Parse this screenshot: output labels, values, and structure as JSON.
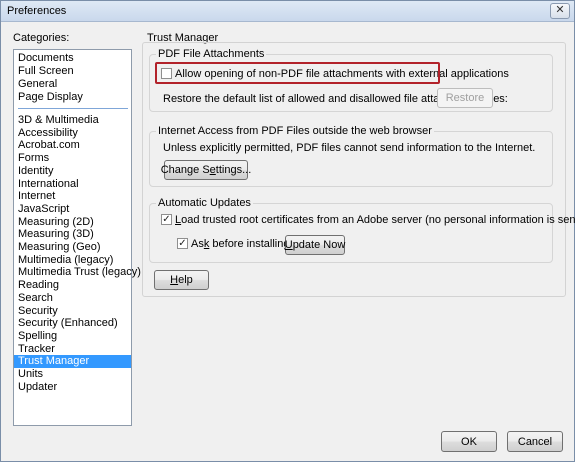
{
  "window": {
    "title": "Preferences",
    "close_glyph": "✕"
  },
  "categories": {
    "label": "Categories:",
    "items": [
      "Documents",
      "Full Screen",
      "General",
      "Page Display",
      "3D & Multimedia",
      "Accessibility",
      "Acrobat.com",
      "Forms",
      "Identity",
      "International",
      "Internet",
      "JavaScript",
      "Measuring (2D)",
      "Measuring (3D)",
      "Measuring (Geo)",
      "Multimedia (legacy)",
      "Multimedia Trust (legacy)",
      "Reading",
      "Search",
      "Security",
      "Security (Enhanced)",
      "Spelling",
      "Tracker",
      "Trust Manager",
      "Units",
      "Updater"
    ],
    "selected": "Trust Manager"
  },
  "trust_manager": {
    "title": "Trust Manager",
    "pdf_attachments": {
      "title": "PDF File Attachments",
      "allow_label": "Allow opening of non-PDF file attachments with external applications",
      "allow_checked": false,
      "restore_text": "Restore the default list of allowed and disallowed file attachment types:",
      "restore_button": "Restore"
    },
    "internet_access": {
      "title": "Internet Access from PDF Files outside the web browser",
      "text": "Unless explicitly permitted, PDF files cannot send information to the Internet.",
      "change_button": "Change Settings..."
    },
    "automatic_updates": {
      "title": "Automatic Updates",
      "load_label": "Load trusted root certificates from an Adobe server (no personal information is sent)",
      "load_checked": true,
      "ask_label": "Ask before installing",
      "ask_checked": true,
      "update_button": "Update Now"
    },
    "help_button": "Help"
  },
  "footer": {
    "ok_button": "OK",
    "cancel_button": "Cancel"
  },
  "colors": {
    "selection": "#3399ff",
    "highlight_border": "#b2222a"
  }
}
